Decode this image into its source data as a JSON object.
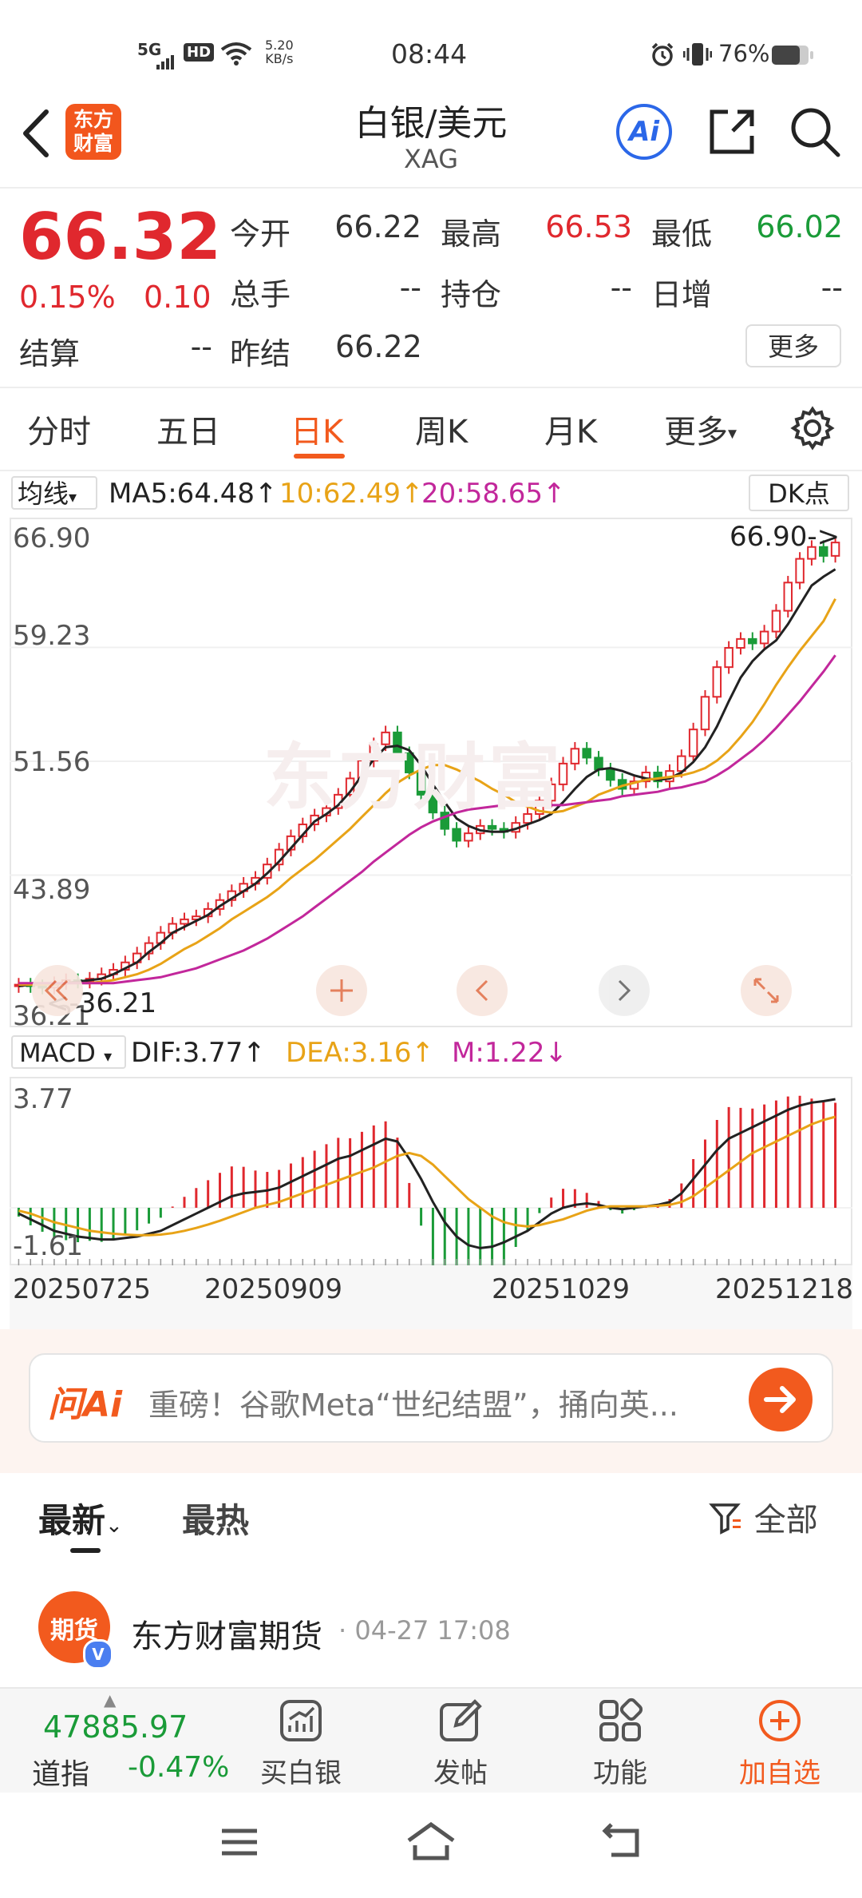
{
  "status_bar": {
    "network": "5G",
    "hd": "HD",
    "speed": "5.20",
    "speed_unit": "KB/s",
    "time": "08:44",
    "battery": "76%"
  },
  "header": {
    "logo_line1": "东方",
    "logo_line2": "财富",
    "title": "白银/美元",
    "subtitle": "XAG",
    "ai_label": "Ai"
  },
  "quote": {
    "price": "66.32",
    "change_pct": "0.15%",
    "change": "0.10",
    "fields": {
      "open_label": "今开",
      "open": "66.22",
      "high_label": "最高",
      "high": "66.53",
      "low_label": "最低",
      "low": "66.02",
      "volume_label": "总手",
      "volume": "--",
      "position_label": "持仓",
      "position": "--",
      "daily_inc_label": "日增",
      "daily_inc": "--",
      "settle_label": "结算",
      "settle": "--",
      "prev_settle_label": "昨结",
      "prev_settle": "66.22"
    },
    "more_button": "更多"
  },
  "tabs": [
    "分时",
    "五日",
    "日K",
    "周K",
    "月K",
    "更多"
  ],
  "active_tab": "日K",
  "ma_bar": {
    "selector": "均线",
    "ma5": "MA5:64.48",
    "ma10": "10:62.49",
    "ma20": "20:58.65",
    "dk_button": "DK点"
  },
  "kline": {
    "y_labels": [
      "66.90",
      "59.23",
      "51.56",
      "43.89",
      "36.21"
    ],
    "high_marker": "66.90->",
    "low_marker": "<-36.21"
  },
  "macd_bar": {
    "selector": "MACD",
    "dif": "DIF:3.77",
    "dea": "DEA:3.16",
    "m": "M:1.22"
  },
  "macd": {
    "y_labels": [
      "3.77",
      "-1.61"
    ]
  },
  "dates": [
    "20250725",
    "20250909",
    "20251029",
    "20251218"
  ],
  "chart_data": {
    "type": "candlestick",
    "ylim": [
      36.21,
      66.9
    ],
    "close": [
      36.5,
      36.4,
      36.3,
      36.6,
      36.8,
      36.7,
      36.9,
      37.2,
      37.5,
      38.0,
      38.6,
      39.3,
      40.0,
      40.6,
      40.9,
      41.1,
      41.6,
      42.2,
      42.8,
      43.3,
      43.7,
      44.6,
      45.6,
      46.5,
      47.3,
      47.9,
      48.4,
      49.3,
      50.4,
      51.6,
      52.7,
      53.5,
      52.1,
      50.8,
      49.3,
      48.1,
      47.0,
      46.2,
      46.7,
      47.2,
      47.0,
      46.8,
      47.4,
      48.0,
      48.9,
      50.0,
      51.4,
      52.4,
      51.8,
      51.0,
      50.3,
      49.7,
      50.2,
      50.8,
      50.2,
      50.9,
      51.9,
      53.7,
      55.9,
      57.9,
      59.2,
      59.8,
      59.5,
      60.3,
      61.7,
      63.6,
      65.2,
      66.0,
      65.4,
      66.3
    ],
    "ma5": [
      36.4,
      36.5,
      36.5,
      36.5,
      36.6,
      36.7,
      36.8,
      36.9,
      37.2,
      37.6,
      38.0,
      38.7,
      39.3,
      40.0,
      40.4,
      40.8,
      41.2,
      41.8,
      42.3,
      42.8,
      43.3,
      44.0,
      44.8,
      45.7,
      46.6,
      47.5,
      48.0,
      48.6,
      49.5,
      50.6,
      51.7,
      52.5,
      52.6,
      52.3,
      51.3,
      50.0,
      48.8,
      47.7,
      47.2,
      46.9,
      46.8,
      46.8,
      47.0,
      47.3,
      47.6,
      48.0,
      48.8,
      49.7,
      50.5,
      51.0,
      51.1,
      50.9,
      50.6,
      50.4,
      50.3,
      50.4,
      50.8,
      51.5,
      52.5,
      53.9,
      55.6,
      57.2,
      58.3,
      59.1,
      59.7,
      60.8,
      62.1,
      63.4,
      64.0,
      64.5
    ],
    "ma10": [
      36.5,
      36.5,
      36.5,
      36.5,
      36.6,
      36.6,
      36.6,
      36.7,
      36.8,
      37.0,
      37.2,
      37.5,
      37.9,
      38.4,
      38.9,
      39.3,
      39.8,
      40.3,
      40.9,
      41.4,
      41.9,
      42.4,
      43.0,
      43.7,
      44.3,
      44.9,
      45.6,
      46.3,
      47.0,
      47.8,
      48.6,
      49.4,
      50.1,
      50.6,
      51.0,
      51.3,
      51.3,
      51.0,
      50.6,
      50.2,
      49.7,
      49.3,
      48.8,
      48.5,
      48.2,
      48.1,
      48.2,
      48.5,
      48.8,
      49.3,
      49.6,
      49.9,
      50.1,
      50.3,
      50.4,
      50.5,
      50.6,
      50.8,
      51.1,
      51.6,
      52.3,
      53.2,
      54.2,
      55.4,
      56.7,
      57.9,
      59.0,
      60.0,
      61.0,
      62.5
    ],
    "ma20": [
      36.6,
      36.6,
      36.6,
      36.6,
      36.6,
      36.6,
      36.6,
      36.6,
      36.6,
      36.7,
      36.8,
      36.9,
      37.0,
      37.2,
      37.4,
      37.6,
      37.9,
      38.2,
      38.5,
      38.8,
      39.2,
      39.6,
      40.1,
      40.6,
      41.1,
      41.7,
      42.3,
      42.9,
      43.5,
      44.1,
      44.8,
      45.4,
      46.0,
      46.6,
      47.1,
      47.5,
      47.8,
      48.1,
      48.3,
      48.4,
      48.5,
      48.6,
      48.6,
      48.6,
      48.6,
      48.6,
      48.6,
      48.7,
      48.8,
      48.9,
      49.0,
      49.2,
      49.3,
      49.4,
      49.5,
      49.7,
      49.8,
      50.0,
      50.2,
      50.6,
      51.1,
      51.7,
      52.3,
      53.0,
      53.8,
      54.7,
      55.6,
      56.6,
      57.6,
      58.7
    ],
    "dif": [
      -0.2,
      -0.4,
      -0.6,
      -0.8,
      -0.9,
      -1.0,
      -1.05,
      -1.1,
      -1.1,
      -1.05,
      -1.0,
      -0.9,
      -0.8,
      -0.6,
      -0.4,
      -0.2,
      0.0,
      0.2,
      0.4,
      0.5,
      0.55,
      0.6,
      0.7,
      0.9,
      1.1,
      1.3,
      1.5,
      1.7,
      1.8,
      2.0,
      2.2,
      2.4,
      2.3,
      1.7,
      1.0,
      0.2,
      -0.5,
      -1.0,
      -1.3,
      -1.4,
      -1.35,
      -1.2,
      -1.0,
      -0.8,
      -0.5,
      -0.2,
      0.0,
      0.1,
      0.15,
      0.1,
      0.0,
      -0.05,
      0.0,
      0.05,
      0.1,
      0.2,
      0.5,
      1.0,
      1.5,
      2.0,
      2.4,
      2.6,
      2.8,
      3.0,
      3.2,
      3.4,
      3.55,
      3.65,
      3.7,
      3.77
    ],
    "dea": [
      -0.1,
      -0.2,
      -0.35,
      -0.5,
      -0.6,
      -0.7,
      -0.8,
      -0.85,
      -0.9,
      -0.93,
      -0.95,
      -0.95,
      -0.93,
      -0.88,
      -0.8,
      -0.7,
      -0.58,
      -0.45,
      -0.3,
      -0.15,
      0.0,
      0.1,
      0.2,
      0.35,
      0.5,
      0.65,
      0.8,
      0.95,
      1.1,
      1.25,
      1.4,
      1.6,
      1.8,
      1.9,
      1.8,
      1.5,
      1.1,
      0.7,
      0.3,
      0.0,
      -0.3,
      -0.5,
      -0.6,
      -0.65,
      -0.6,
      -0.5,
      -0.4,
      -0.25,
      -0.1,
      0.0,
      0.05,
      0.05,
      0.05,
      0.05,
      0.07,
      0.1,
      0.2,
      0.4,
      0.7,
      1.0,
      1.3,
      1.6,
      1.9,
      2.1,
      2.3,
      2.5,
      2.7,
      2.9,
      3.05,
      3.16
    ]
  },
  "ai_bar": {
    "brand": "问Ai",
    "placeholder": "重磅！谷歌Meta“世纪结盟”，捅向英..."
  },
  "feed": {
    "tab_latest": "最新",
    "tab_hot": "最热",
    "filter": "全部",
    "author": "东方财富期货",
    "time": "04-27 17:08",
    "avatar_text": "期货"
  },
  "bottom_nav": {
    "index_value": "47885.97",
    "index_name": "道指",
    "index_change": "-0.47%",
    "items": [
      "买白银",
      "发帖",
      "功能",
      "加自选"
    ]
  },
  "colors": {
    "up": "#e0282e",
    "down": "#1a9b38",
    "accent": "#f25a1e",
    "ma10": "#e8a317",
    "ma20": "#c2279b"
  }
}
